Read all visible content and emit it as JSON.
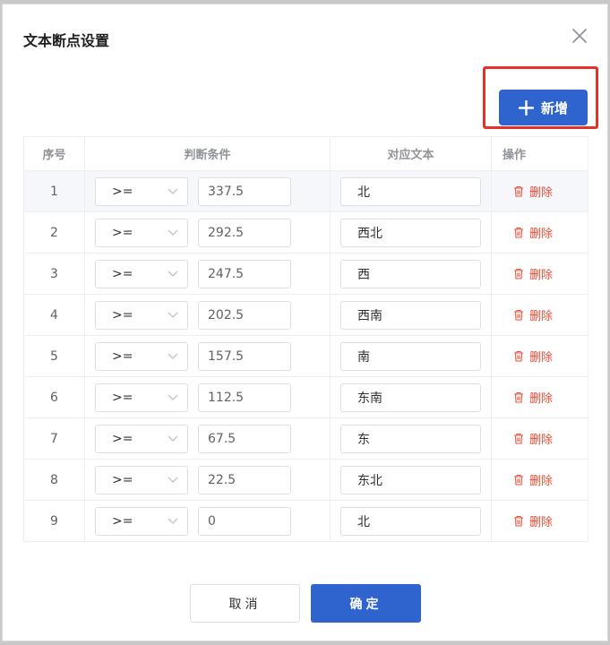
{
  "dialog": {
    "title": "文本断点设置"
  },
  "toolbar": {
    "add_label": "新增"
  },
  "table": {
    "headers": {
      "index": "序号",
      "condition": "判断条件",
      "text": "对应文本",
      "action": "操作"
    },
    "delete_label": "删除",
    "rows": [
      {
        "index": "1",
        "operator": ">=",
        "value": "337.5",
        "text": "北"
      },
      {
        "index": "2",
        "operator": ">=",
        "value": "292.5",
        "text": "西北"
      },
      {
        "index": "3",
        "operator": ">=",
        "value": "247.5",
        "text": "西"
      },
      {
        "index": "4",
        "operator": ">=",
        "value": "202.5",
        "text": "西南"
      },
      {
        "index": "5",
        "operator": ">=",
        "value": "157.5",
        "text": "南"
      },
      {
        "index": "6",
        "operator": ">=",
        "value": "112.5",
        "text": "东南"
      },
      {
        "index": "7",
        "operator": ">=",
        "value": "67.5",
        "text": "东"
      },
      {
        "index": "8",
        "operator": ">=",
        "value": "22.5",
        "text": "东北"
      },
      {
        "index": "9",
        "operator": ">=",
        "value": "0",
        "text": "北"
      }
    ]
  },
  "footer": {
    "cancel_label": "取消",
    "confirm_label": "确定"
  },
  "colors": {
    "primary": "#2f63ce",
    "danger": "#e8503a",
    "highlight": "#e8302a"
  },
  "icons": {
    "close": "close-icon",
    "add": "plus-icon",
    "delete": "trash-icon",
    "dropdown": "chevron-down-icon"
  }
}
